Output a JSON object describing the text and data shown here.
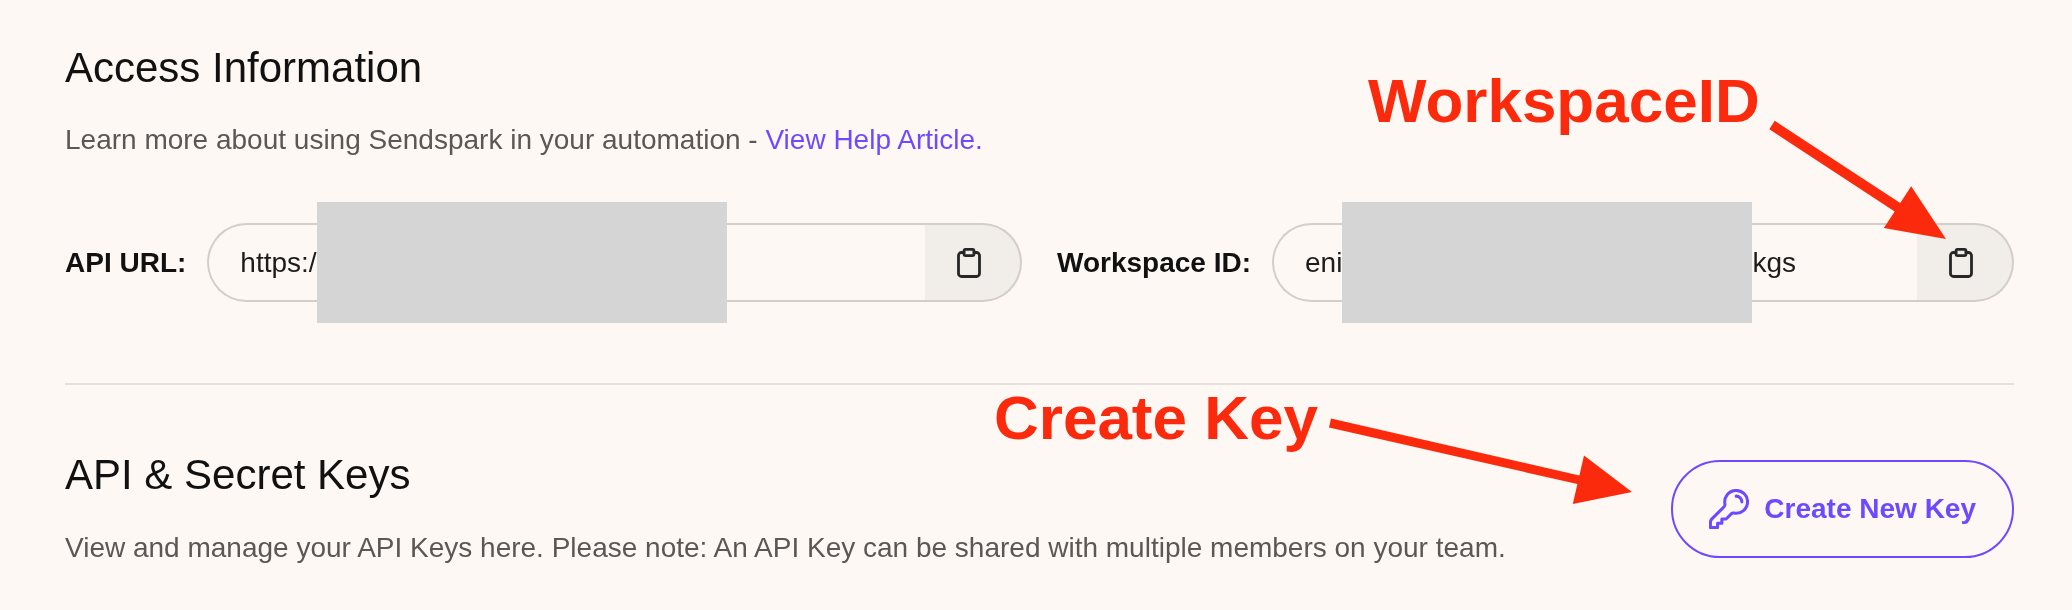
{
  "access_information": {
    "title": "Access Information",
    "description": "Learn more about using Sendspark in your automation -",
    "link": "View Help Article.",
    "fields": [
      {
        "label": "API URL:",
        "value_start": "https:/",
        "redacted": true
      },
      {
        "label": "Workspace ID:",
        "value_start": "eni",
        "redacted": true,
        "value_end": "kgs"
      }
    ]
  },
  "api_keys": {
    "title": "API & Secret Keys",
    "description": "View and manage your API Keys here. Please note: An API Key can be shared with multiple members on your team.",
    "button": {
      "label": "Create New Key"
    }
  },
  "annotations": [
    {
      "label": "WorkspaceID"
    },
    {
      "label": "Create Key"
    }
  ]
}
